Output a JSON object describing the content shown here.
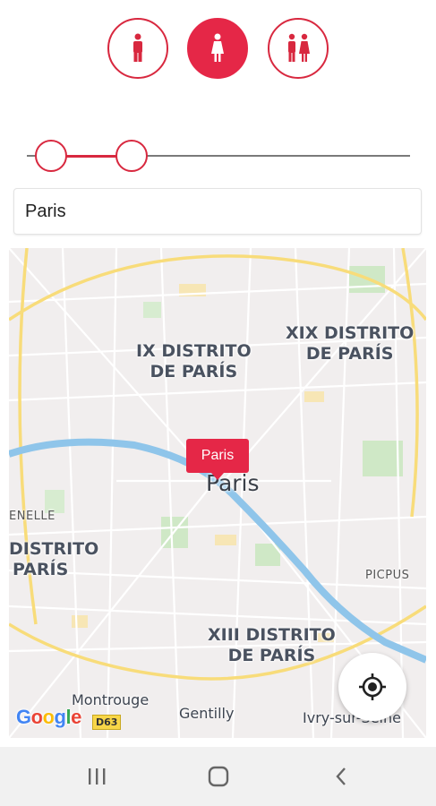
{
  "gender_filter": {
    "options": [
      {
        "name": "male",
        "icon": "male-person-icon",
        "selected": false
      },
      {
        "name": "female",
        "icon": "female-person-icon",
        "selected": true
      },
      {
        "name": "both",
        "icon": "couple-icon",
        "selected": false
      }
    ],
    "accent_color": "#e52747"
  },
  "range_slider": {
    "low": 0.06,
    "high": 0.27
  },
  "location_input": {
    "value": "Paris"
  },
  "map": {
    "marker_label": "Paris",
    "city_label": "Paris",
    "labels": {
      "district_9": [
        "IX DISTRITO",
        "DE PARÍS"
      ],
      "district_19": [
        "XIX DISTRITO",
        "DE PARÍS"
      ],
      "district_13": [
        "XIII DISTRITO",
        "DE PARÍS"
      ],
      "district_left": [
        "DISTRITO",
        "PARÍS"
      ],
      "grenelle": "ENELLE",
      "picpus": "PICPUS",
      "montrouge": "Montrouge",
      "gentilly": "Gentilly",
      "ivry": "Ivry-sur-Seine",
      "route": "D63"
    },
    "attribution": "Google",
    "locate_icon": "my-location-icon"
  },
  "system_nav": {
    "recents_icon": "recents-icon",
    "home_icon": "home-icon",
    "back_icon": "back-icon"
  }
}
